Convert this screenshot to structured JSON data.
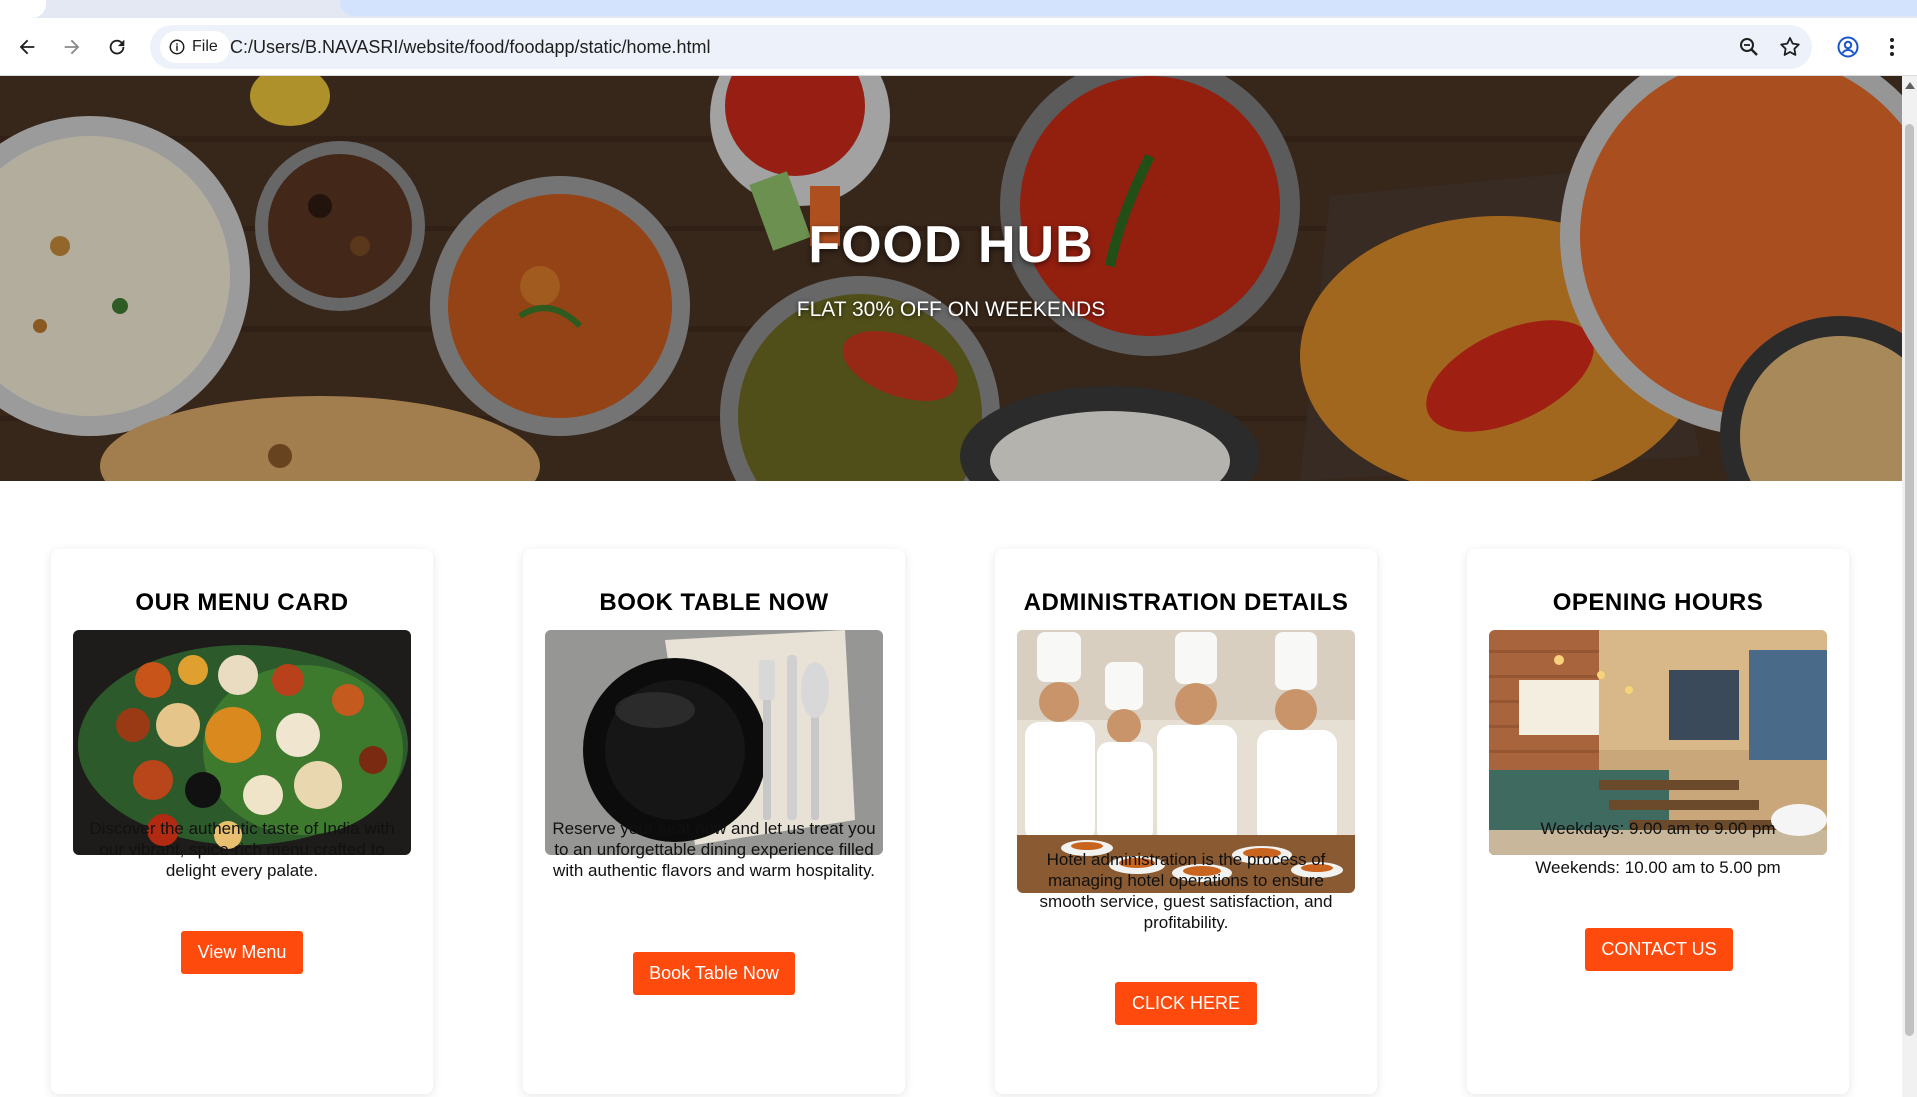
{
  "browser": {
    "site_chip_label": "File",
    "url": "C:/Users/B.NAVASRI/website/food/foodapp/static/home.html"
  },
  "hero": {
    "title": "FOOD HUB",
    "subtitle": "FLAT 30% OFF ON WEEKENDS"
  },
  "cards": [
    {
      "title": "OUR MENU CARD",
      "description": "Discover the authentic taste of India with our vibrant, spice-rich menu crafted to delight every palate.",
      "button": "View Menu"
    },
    {
      "title": "BOOK TABLE NOW",
      "description": "Reserve your seat now and let us treat you to an unforgettable dining experience filled with authentic flavors and warm hospitality.",
      "button": "Book Table Now"
    },
    {
      "title": "ADMINISTRATION DETAILS",
      "description": "Hotel administration is the process of managing hotel operations to ensure smooth service, guest satisfaction, and profitability.",
      "button": "CLICK HERE"
    },
    {
      "title": "OPENING HOURS",
      "weekdays": "Weekdays: 9.00 am to 9.00 pm",
      "weekends": "Weekends: 10.00 am to 5.00 pm",
      "button": "CONTACT US"
    }
  ],
  "colors": {
    "accent_button": "#ff4a0d",
    "omnibox_bg": "#edf2fa"
  }
}
